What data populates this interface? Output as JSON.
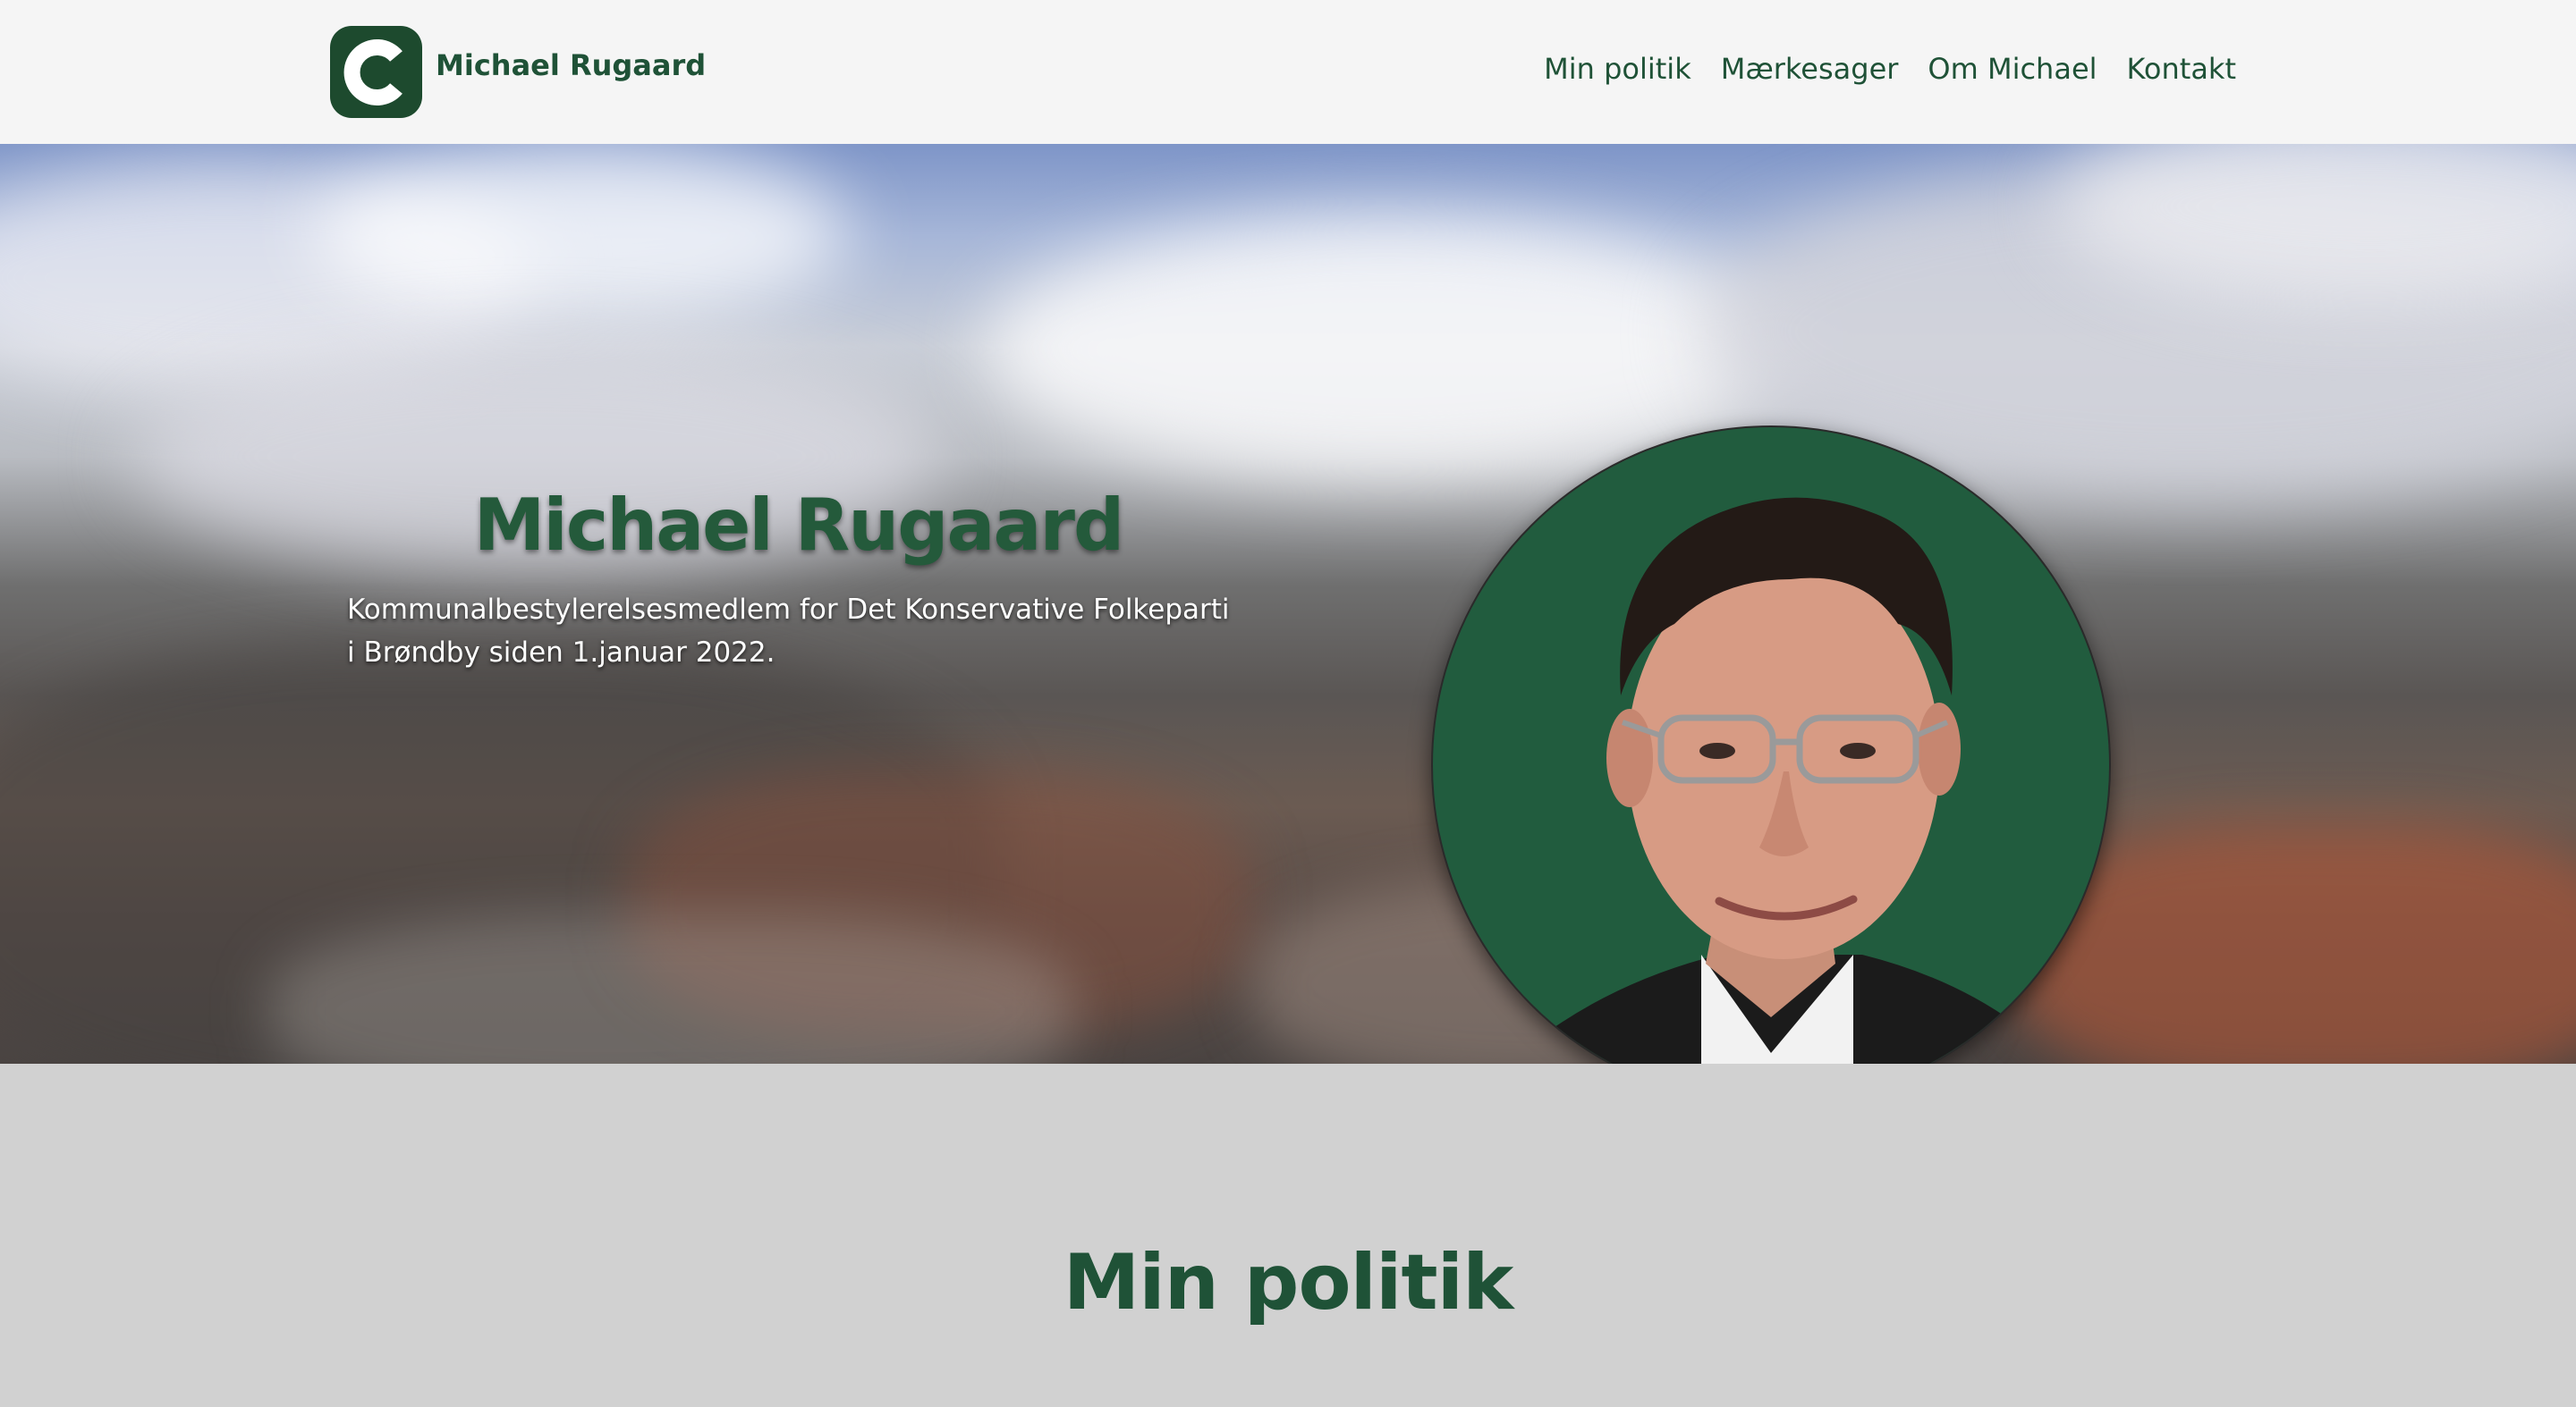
{
  "header": {
    "logo_letter": "C",
    "brand_name": "Michael Rugaard",
    "nav": [
      "Min politik",
      "Mærkesager",
      "Om Michael",
      "Kontakt"
    ]
  },
  "hero": {
    "title": "Michael Rugaard",
    "subtitle": "Kommunalbestylerelsesmedlem for Det Konservative Folkeparti i Brøndby siden 1.januar 2022."
  },
  "section": {
    "title": "Min politik"
  },
  "colors": {
    "brand_green": "#1f5237",
    "logo_bg": "#1d4a2e",
    "portrait_bg": "#215c3e",
    "header_bg": "#f5f5f5",
    "section_bg": "#d1d1d1"
  }
}
